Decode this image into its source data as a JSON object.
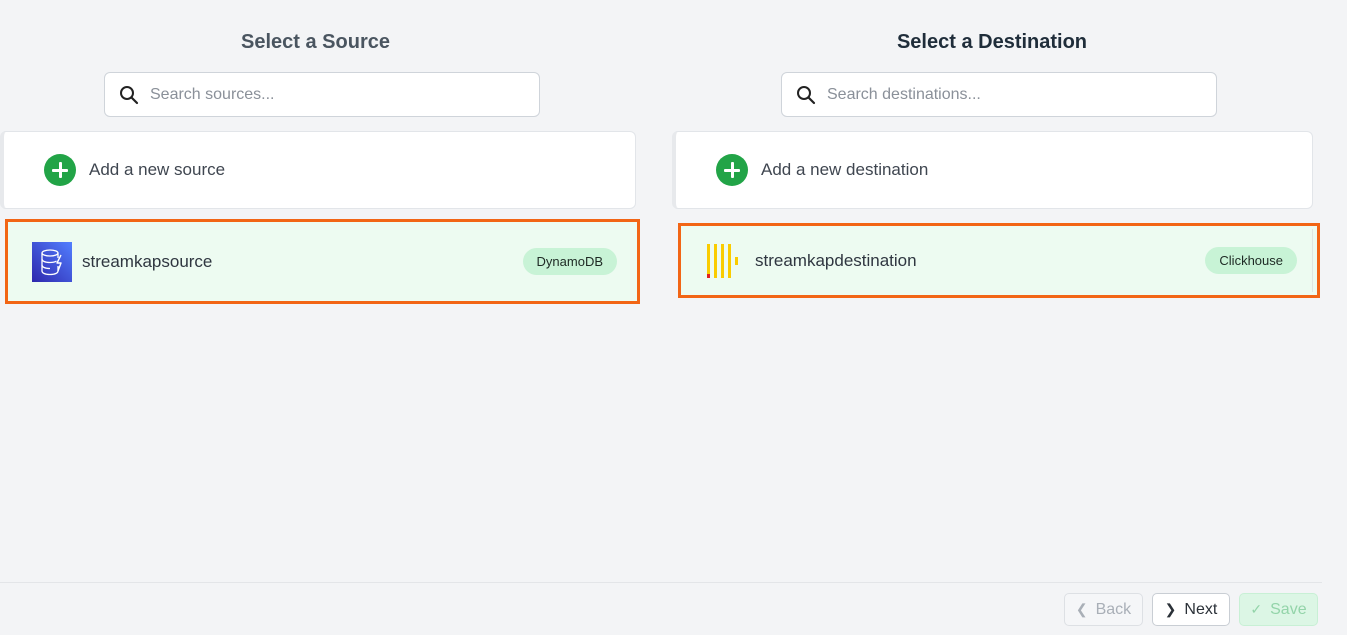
{
  "source": {
    "title": "Select a Source",
    "search_placeholder": "Search sources...",
    "add_label": "Add a new source",
    "selected": {
      "name": "streamkapsource",
      "badge": "DynamoDB",
      "icon": "dynamodb-icon"
    }
  },
  "destination": {
    "title": "Select a Destination",
    "search_placeholder": "Search destinations...",
    "add_label": "Add a new destination",
    "selected": {
      "name": "streamkapdestination",
      "badge": "Clickhouse",
      "icon": "clickhouse-icon"
    }
  },
  "footer": {
    "back_label": "Back",
    "next_label": "Next",
    "save_label": "Save"
  },
  "colors": {
    "highlight": "#f26515",
    "selected_bg": "#edfbf1",
    "add_icon": "#22a447",
    "badge_bg": "#c8f3d6",
    "dynamodb": "#3b48cc",
    "clickhouse_yellow": "#facc00",
    "clickhouse_red": "#e02020"
  }
}
